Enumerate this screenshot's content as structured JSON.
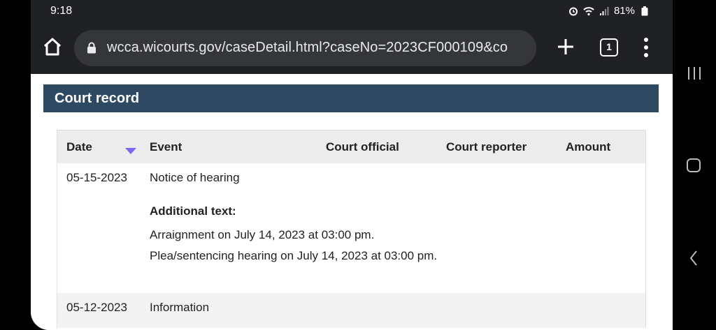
{
  "status_bar": {
    "time": "9:18",
    "battery": "81%",
    "icons": [
      "alarm-icon",
      "wifi-icon",
      "signal-icon",
      "battery-icon"
    ]
  },
  "browser": {
    "url": "wcca.wicourts.gov/caseDetail.html?caseNo=2023CF000109&co",
    "tab_count": "1"
  },
  "section": {
    "title": "Court record"
  },
  "table": {
    "columns": [
      "Date",
      "Event",
      "Court official",
      "Court reporter",
      "Amount"
    ],
    "rows": [
      {
        "date": "05-15-2023",
        "event": "Notice of hearing",
        "additional_label": "Additional text:",
        "additional_lines": [
          "Arraignment on July 14, 2023 at 03:00 pm.",
          "Plea/sentencing hearing on July 14, 2023 at 03:00 pm."
        ]
      },
      {
        "date": "05-12-2023",
        "event": "Information"
      }
    ]
  },
  "colors": {
    "header_bg": "#2e4a63",
    "sort_arrow": "#7b68ee",
    "browser_bg": "#202124"
  }
}
